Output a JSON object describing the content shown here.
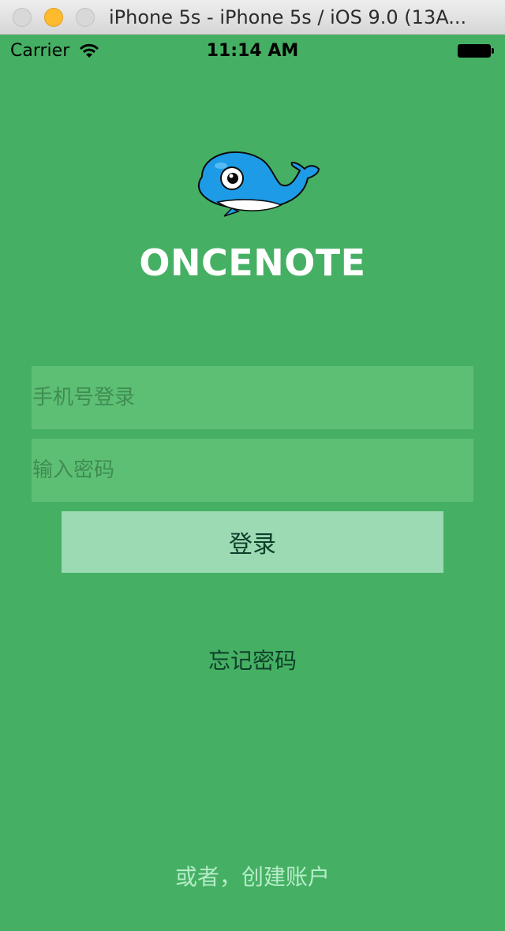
{
  "window": {
    "title": "iPhone 5s - iPhone 5s / iOS 9.0 (13A..."
  },
  "status_bar": {
    "carrier": "Carrier",
    "time": "11:14 AM"
  },
  "app": {
    "name": "ONCENOTE",
    "logo_icon": "whale-logo-icon"
  },
  "login_form": {
    "phone_placeholder": "手机号登录",
    "password_placeholder": "输入密码",
    "login_label": "登录",
    "forgot_label": "忘记密码",
    "create_account_label": "或者，创建账户"
  },
  "colors": {
    "background": "#45b063",
    "field": "#5dbf74",
    "button": "#9bdab3",
    "dark_text": "#0f3f2a",
    "light_text": "#b6ecc8"
  }
}
